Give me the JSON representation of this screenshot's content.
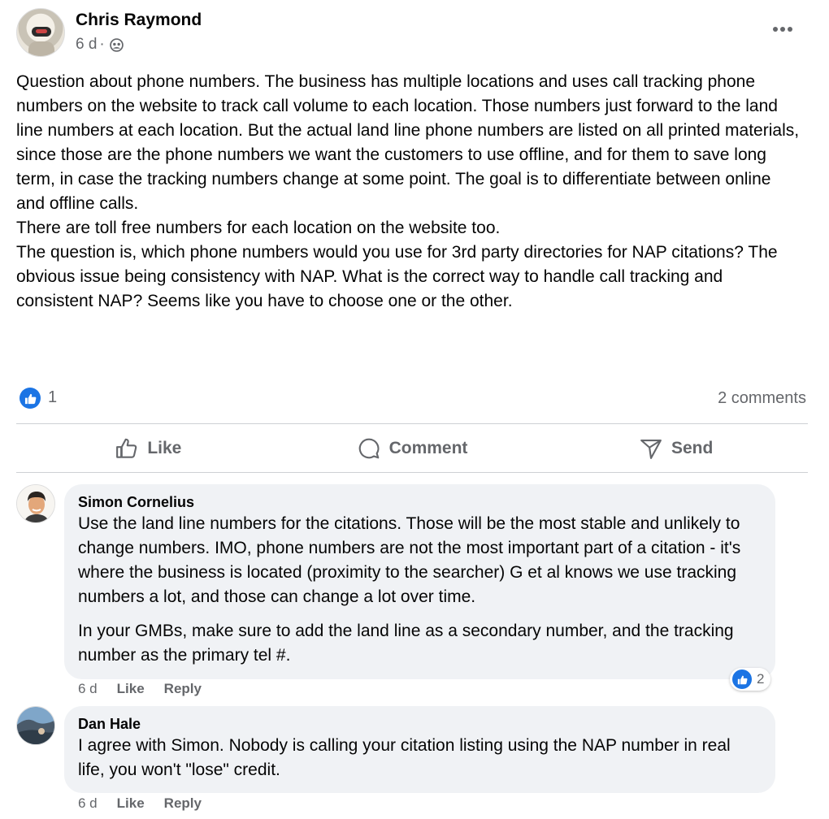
{
  "post": {
    "author": "Chris Raymond",
    "time": "6 d",
    "separator": "·",
    "privacy_icon": "group-icon",
    "more_icon": "more-horizontal-icon",
    "paragraphs": [
      "Question about phone numbers. The business has multiple locations and uses call tracking phone numbers on the website to track call volume to each location. Those numbers just forward to the land line numbers at each location. But the actual land line phone numbers are listed on all printed materials, since those are the phone numbers we want the customers to use offline, and for them to save long term, in case the tracking numbers change at some point. The goal is to differentiate between online and offline calls.",
      "There are toll free numbers for each location on the website too.",
      "The question is, which phone numbers would you use for 3rd party directories for NAP citations? The obvious issue being consistency with NAP. What is the correct way to handle call tracking and consistent NAP? Seems like you have to choose one or the other."
    ]
  },
  "reactions": {
    "count": "1",
    "comments_label": "2 comments",
    "accent": "#1b74e4"
  },
  "actions": {
    "like": "Like",
    "comment": "Comment",
    "send": "Send"
  },
  "comments": [
    {
      "name": "Simon Cornelius",
      "paragraphs": [
        "Use the land line numbers for the citations. Those will be the most stable and unlikely to change numbers. IMO, phone numbers are not the most important part of a citation - it's where the business is located (proximity to the searcher) G et al knows we use tracking numbers a lot, and those can change a lot over time.",
        "In your GMBs, make sure to add the land line as a secondary number, and the tracking number as the primary tel #."
      ],
      "time": "6 d",
      "like": "Like",
      "reply": "Reply",
      "reaction_count": "2"
    },
    {
      "name": "Dan Hale",
      "paragraphs": [
        "I agree with Simon. Nobody is calling your citation listing using the NAP number in real life, you won't \"lose\" credit."
      ],
      "time": "6 d",
      "like": "Like",
      "reply": "Reply"
    }
  ]
}
